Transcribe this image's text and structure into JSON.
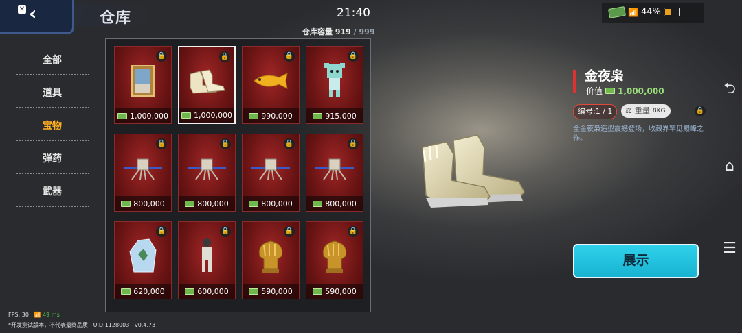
{
  "header": {
    "title": "仓库",
    "clock": "21:40",
    "battery": "44%",
    "capacity_label": "仓库容量",
    "capacity_used": "919",
    "capacity_max": "999"
  },
  "sidebar": {
    "items": [
      {
        "label": "全部",
        "active": false
      },
      {
        "label": "道具",
        "active": false
      },
      {
        "label": "宝物",
        "active": true
      },
      {
        "label": "弹药",
        "active": false
      },
      {
        "label": "武器",
        "active": false
      }
    ]
  },
  "grid": {
    "items": [
      {
        "icon": "painting-icon",
        "price": "1,000,000",
        "selected": false
      },
      {
        "icon": "sneakers-icon",
        "price": "1,000,000",
        "selected": true
      },
      {
        "icon": "golden-fish-icon",
        "price": "990,000",
        "selected": false
      },
      {
        "icon": "plush-doll-icon",
        "price": "915,000",
        "selected": false
      },
      {
        "icon": "lunar-lander-icon",
        "price": "800,000",
        "selected": false
      },
      {
        "icon": "lunar-lander-icon",
        "price": "800,000",
        "selected": false
      },
      {
        "icon": "lunar-lander-icon",
        "price": "800,000",
        "selected": false
      },
      {
        "icon": "lunar-lander-icon",
        "price": "800,000",
        "selected": false
      },
      {
        "icon": "ice-crystal-icon",
        "price": "620,000",
        "selected": false
      },
      {
        "icon": "astronaut-figure-icon",
        "price": "600,000",
        "selected": false
      },
      {
        "icon": "golden-trophy-icon",
        "price": "590,000",
        "selected": false
      },
      {
        "icon": "golden-trophy-icon",
        "price": "590,000",
        "selected": false
      }
    ]
  },
  "detail": {
    "name": "金夜枭",
    "value_label": "价值",
    "value": "1,000,000",
    "serial": "编号:1 / 1",
    "weight_label": "重量",
    "weight": "8KG",
    "description": "全金夜枭造型震撼登场，收藏界罕见巅峰之作。",
    "show_button": "展示"
  },
  "footer": {
    "fps": "FPS: 30",
    "ping": "49 ms",
    "notice": "*开发测试版本，不代表最终品质",
    "uid": "UID:1128003",
    "version": "v0.4.73"
  }
}
